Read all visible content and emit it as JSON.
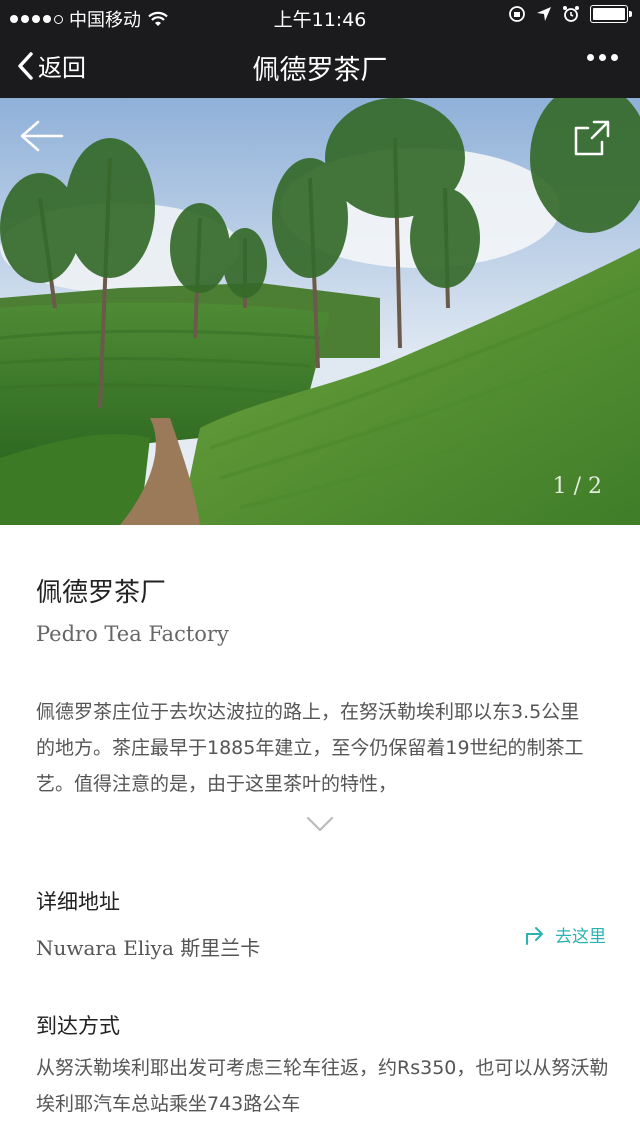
{
  "status_bar": {
    "carrier": "中国移动",
    "time": "上午11:46"
  },
  "nav": {
    "back_label": "返回",
    "title": "佩德罗茶厂"
  },
  "hero": {
    "counter": "1 / 2"
  },
  "place": {
    "name_cn": "佩德罗茶厂",
    "name_en": "Pedro Tea Factory",
    "description": "佩德罗茶庄位于去坎达波拉的路上，在努沃勒埃利耶以东3.5公里的地方。茶庄最早于1885年建立，至今仍保留着19世纪的制茶工艺。值得注意的是，由于这里茶叶的特性，"
  },
  "address": {
    "label": "详细地址",
    "value": "Nuwara Eliya 斯里兰卡",
    "go_label": "去这里"
  },
  "arrival": {
    "label": "到达方式",
    "value": "从努沃勒埃利耶出发可考虑三轮车往返，约Rs350，也可以从努沃勒埃利耶汽车总站乘坐743路公车"
  }
}
